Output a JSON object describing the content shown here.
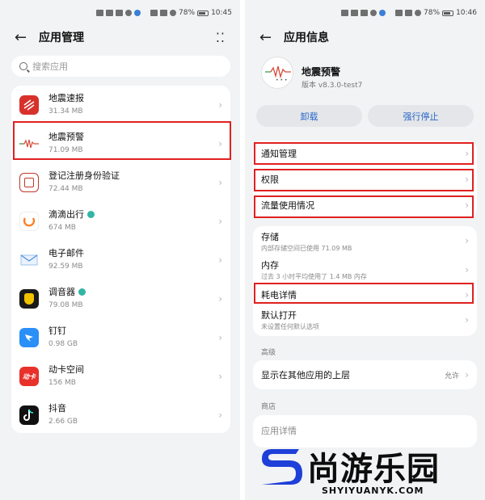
{
  "left": {
    "status": {
      "battery": "78%",
      "time": "10:45"
    },
    "title": "应用管理",
    "search_placeholder": "搜索应用",
    "apps": [
      {
        "name": "地震速报",
        "size": "31.34 MB",
        "icon": "earthquake-news-icon",
        "color": "#d8312b"
      },
      {
        "name": "地震预警",
        "size": "71.09 MB",
        "icon": "earthquake-warning-icon",
        "color": "#ffffff"
      },
      {
        "name": "登记注册身份验证",
        "size": "72.44 MB",
        "icon": "registration-id-icon",
        "color": "#c0392b"
      },
      {
        "name": "滴滴出行",
        "size": "674 MB",
        "icon": "didi-icon",
        "color": "#ff7a1a"
      },
      {
        "name": "电子邮件",
        "size": "92.59 MB",
        "icon": "email-icon",
        "color": "#4a90e2"
      },
      {
        "name": "调音器",
        "size": "79.08 MB",
        "icon": "tuner-icon",
        "color": "#1a1a1a"
      },
      {
        "name": "钉钉",
        "size": "0.98 GB",
        "icon": "dingtalk-icon",
        "color": "#2a8ff7"
      },
      {
        "name": "动卡空间",
        "size": "156 MB",
        "icon": "dongka-icon",
        "color": "#e8312a"
      },
      {
        "name": "抖音",
        "size": "2.66 GB",
        "icon": "douyin-icon",
        "color": "#111111"
      }
    ],
    "dongka_icon_text": "动卡"
  },
  "right": {
    "status": {
      "battery": "78%",
      "time": "10:46"
    },
    "title": "应用信息",
    "app_name": "地震预警",
    "version": "版本 v8.3.0-test7",
    "uninstall": "卸载",
    "force_stop": "强行停止",
    "notification": "通知管理",
    "permissions": "权限",
    "data_usage": "流量使用情况",
    "storage": "存储",
    "storage_sub": "内部存储空间已使用 71.09 MB",
    "memory": "内存",
    "memory_sub": "过去 3 小时平均使用了 1.4 MB 内存",
    "power": "耗电详情",
    "default_open": "默认打开",
    "default_open_sub": "未设置任何默认选项",
    "advanced_label": "高级",
    "overlay": "显示在其他应用的上层",
    "overlay_value": "允许",
    "store_label": "商店",
    "app_details": "应用详情"
  },
  "watermark": {
    "cn": "尚游乐园",
    "en": "SHYIYUANYK.COM"
  },
  "colors": {
    "highlight": "#e02020",
    "accent": "#2a66c8",
    "background": "#f1f3f5"
  }
}
